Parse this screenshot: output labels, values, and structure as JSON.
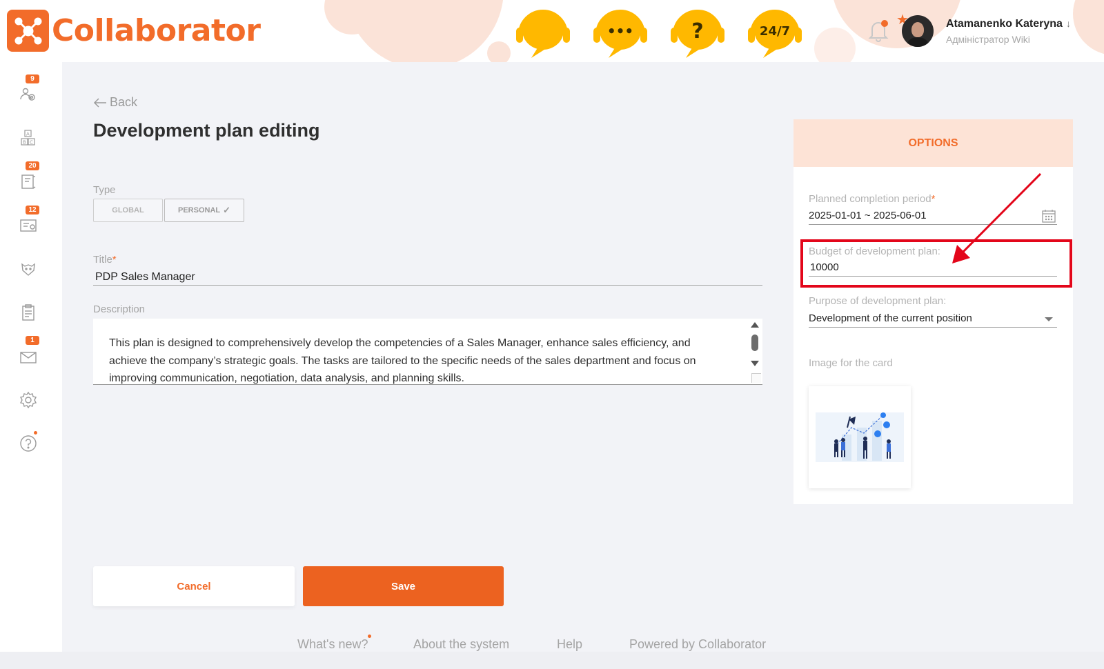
{
  "header": {
    "app_name": "Collaborator",
    "support_icons": [
      {
        "name": "chat-support-icon",
        "label": ""
      },
      {
        "name": "messages-support-icon",
        "label": "•••"
      },
      {
        "name": "help-support-icon",
        "label": "?"
      },
      {
        "name": "support-24-7-icon",
        "label": "24/7"
      }
    ],
    "user": {
      "name": "Atamanenko Kateryna",
      "role": "Адміністратор Wiki",
      "arrow": "↓"
    }
  },
  "sidebar": {
    "items": [
      {
        "name": "sidebar-item-users",
        "icon": "users-gear-icon",
        "badge": "9"
      },
      {
        "name": "sidebar-item-abc",
        "icon": "abc-blocks-icon",
        "badge": ""
      },
      {
        "name": "sidebar-item-courses",
        "icon": "book-icon",
        "badge": "20"
      },
      {
        "name": "sidebar-item-certificates",
        "icon": "certificate-icon",
        "badge": "12"
      },
      {
        "name": "sidebar-item-competencies",
        "icon": "tiger-icon",
        "badge": ""
      },
      {
        "name": "sidebar-item-tasks",
        "icon": "clipboard-icon",
        "badge": ""
      },
      {
        "name": "sidebar-item-messages",
        "icon": "envelope-icon",
        "badge": "1"
      },
      {
        "name": "sidebar-item-settings",
        "icon": "gear-icon",
        "badge": ""
      },
      {
        "name": "sidebar-item-help",
        "icon": "question-icon",
        "badge": ""
      }
    ]
  },
  "page": {
    "back_label": "Back",
    "title": "Development plan editing",
    "type_label": "Type",
    "type_options": [
      "GLOBAL",
      "PERSONAL"
    ],
    "type_selected": "PERSONAL",
    "title_label": "Title",
    "title_required": "*",
    "title_value": "PDP Sales Manager",
    "description_label": "Description",
    "description_value": "This plan is designed to comprehensively develop the competencies of a Sales Manager, enhance sales efficiency, and achieve the company’s strategic goals. The tasks are tailored to the specific needs of the sales department and focus on improving communication, negotiation, data analysis, and planning skills."
  },
  "options": {
    "header": "OPTIONS",
    "period_label": "Planned completion period",
    "period_required": "*",
    "period_value": "2025-01-01 ~ 2025-06-01",
    "budget_label": "Budget of development plan:",
    "budget_value": "10000",
    "purpose_label": "Purpose of development plan:",
    "purpose_value": "Development of the current position",
    "image_label": "Image for the card"
  },
  "buttons": {
    "cancel": "Cancel",
    "save": "Save"
  },
  "footer": {
    "whats_new": "What's new?",
    "about": "About the system",
    "help": "Help",
    "powered": "Powered by Collaborator"
  },
  "colors": {
    "accent": "#f26c2a",
    "support_yellow": "#ffb800",
    "highlight_red": "#e3061a"
  }
}
